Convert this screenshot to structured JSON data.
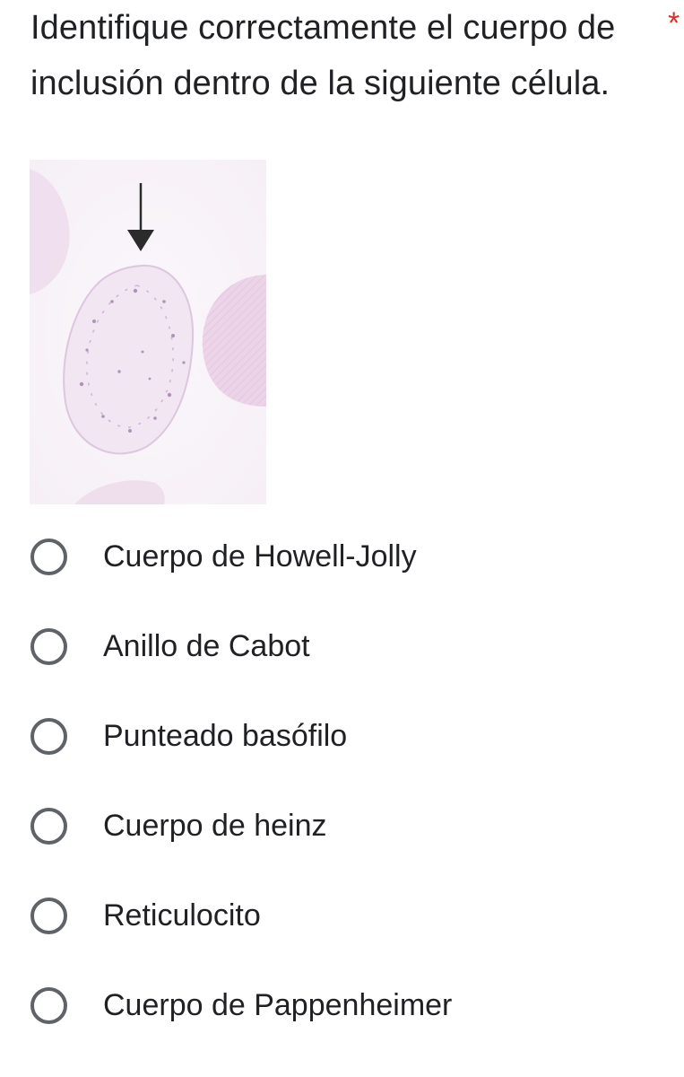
{
  "question": {
    "text": "Identifique correctamente el cuerpo de inclusión dentro de la siguiente célula.",
    "required_marker": "*"
  },
  "image": {
    "description_icon": "blood-cell-micrograph",
    "colors": {
      "cell_fill": "#f3e9f3",
      "cell_dots": "#8f6a98",
      "neighbor_cell": "#ecd6e8",
      "arrow": "#2b2b2b"
    }
  },
  "options": [
    {
      "label": "Cuerpo de Howell-Jolly",
      "selected": false
    },
    {
      "label": "Anillo de Cabot",
      "selected": false
    },
    {
      "label": "Punteado basófilo",
      "selected": false
    },
    {
      "label": "Cuerpo de heinz",
      "selected": false
    },
    {
      "label": "Reticulocito",
      "selected": false
    },
    {
      "label": "Cuerpo de Pappenheimer",
      "selected": false
    }
  ],
  "theme": {
    "text_color": "#202124",
    "radio_border": "#5f6368",
    "required_color": "#d93025"
  }
}
